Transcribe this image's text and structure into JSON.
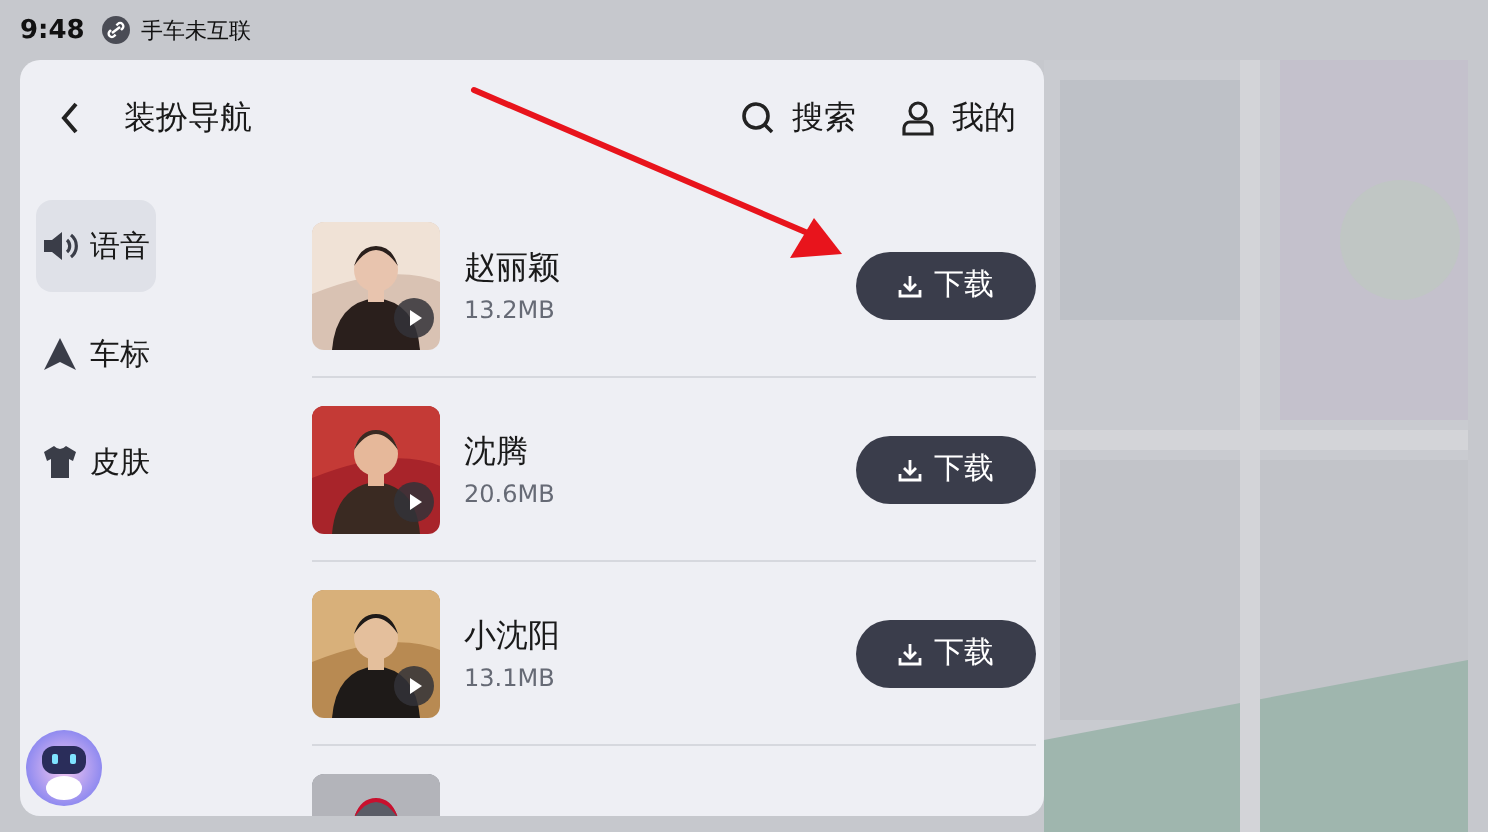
{
  "status_bar": {
    "time": "9:48",
    "connection": "手车未互联"
  },
  "panel": {
    "title": "装扮导航",
    "actions": [
      {
        "label": "搜索"
      },
      {
        "label": "我的"
      }
    ]
  },
  "sidebar": {
    "items": [
      {
        "label": "语音",
        "selected": true
      },
      {
        "label": "车标",
        "selected": false
      },
      {
        "label": "皮肤",
        "selected": false
      }
    ]
  },
  "voices": [
    {
      "name": "赵丽颖",
      "size": "13.2MB",
      "button": "下载",
      "thumb": {
        "kind": "picture"
      }
    },
    {
      "name": "沈腾",
      "size": "20.6MB",
      "button": "下载",
      "thumb": {
        "kind": "picture"
      }
    },
    {
      "name": "小沈阳",
      "size": "13.1MB",
      "button": "下载",
      "thumb": {
        "kind": "picture"
      }
    },
    {
      "thumb": {
        "kind": "picture"
      }
    }
  ]
}
